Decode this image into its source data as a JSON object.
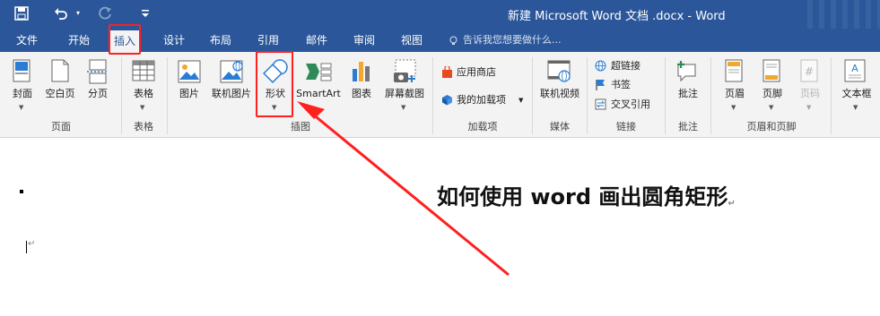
{
  "window": {
    "title": "新建 Microsoft Word 文档 .docx - Word",
    "quick_access": [
      {
        "icon": "save-icon"
      },
      {
        "icon": "undo-icon"
      },
      {
        "icon": "redo-icon"
      },
      {
        "icon": "customize-icon"
      }
    ]
  },
  "tabs": [
    "文件",
    "开始",
    "插入",
    "设计",
    "布局",
    "引用",
    "邮件",
    "审阅",
    "视图"
  ],
  "active_tab": "插入",
  "tell_me": "告诉我您想要做什么...",
  "ribbon": {
    "groups": {
      "pages": "页面",
      "tables": "表格",
      "illustrations": "插图",
      "addins": "加载项",
      "media": "媒体",
      "links": "链接",
      "comments": "批注",
      "header_footer": "页眉和页脚"
    },
    "buttons": {
      "cover": "封面",
      "blank_page": "空白页",
      "page_break": "分页",
      "table": "表格",
      "picture": "图片",
      "online_picture": "联机图片",
      "shapes": "形状",
      "smartart": "SmartArt",
      "chart": "图表",
      "screenshot": "屏幕截图",
      "store": "应用商店",
      "my_addins": "我的加载项",
      "online_video": "联机视频",
      "hyperlink": "超链接",
      "bookmark": "书签",
      "cross_ref": "交叉引用",
      "comment": "批注",
      "header": "页眉",
      "footer": "页脚",
      "page_number": "页码",
      "textbox": "文本框"
    }
  },
  "document": {
    "heading": "如何使用 word 画出圆角矩形",
    "para_mark": "↵"
  },
  "colors": {
    "title_bar": "#2b579a",
    "ribbon_bg": "#f3f3f3",
    "highlight": "#ff2020"
  }
}
